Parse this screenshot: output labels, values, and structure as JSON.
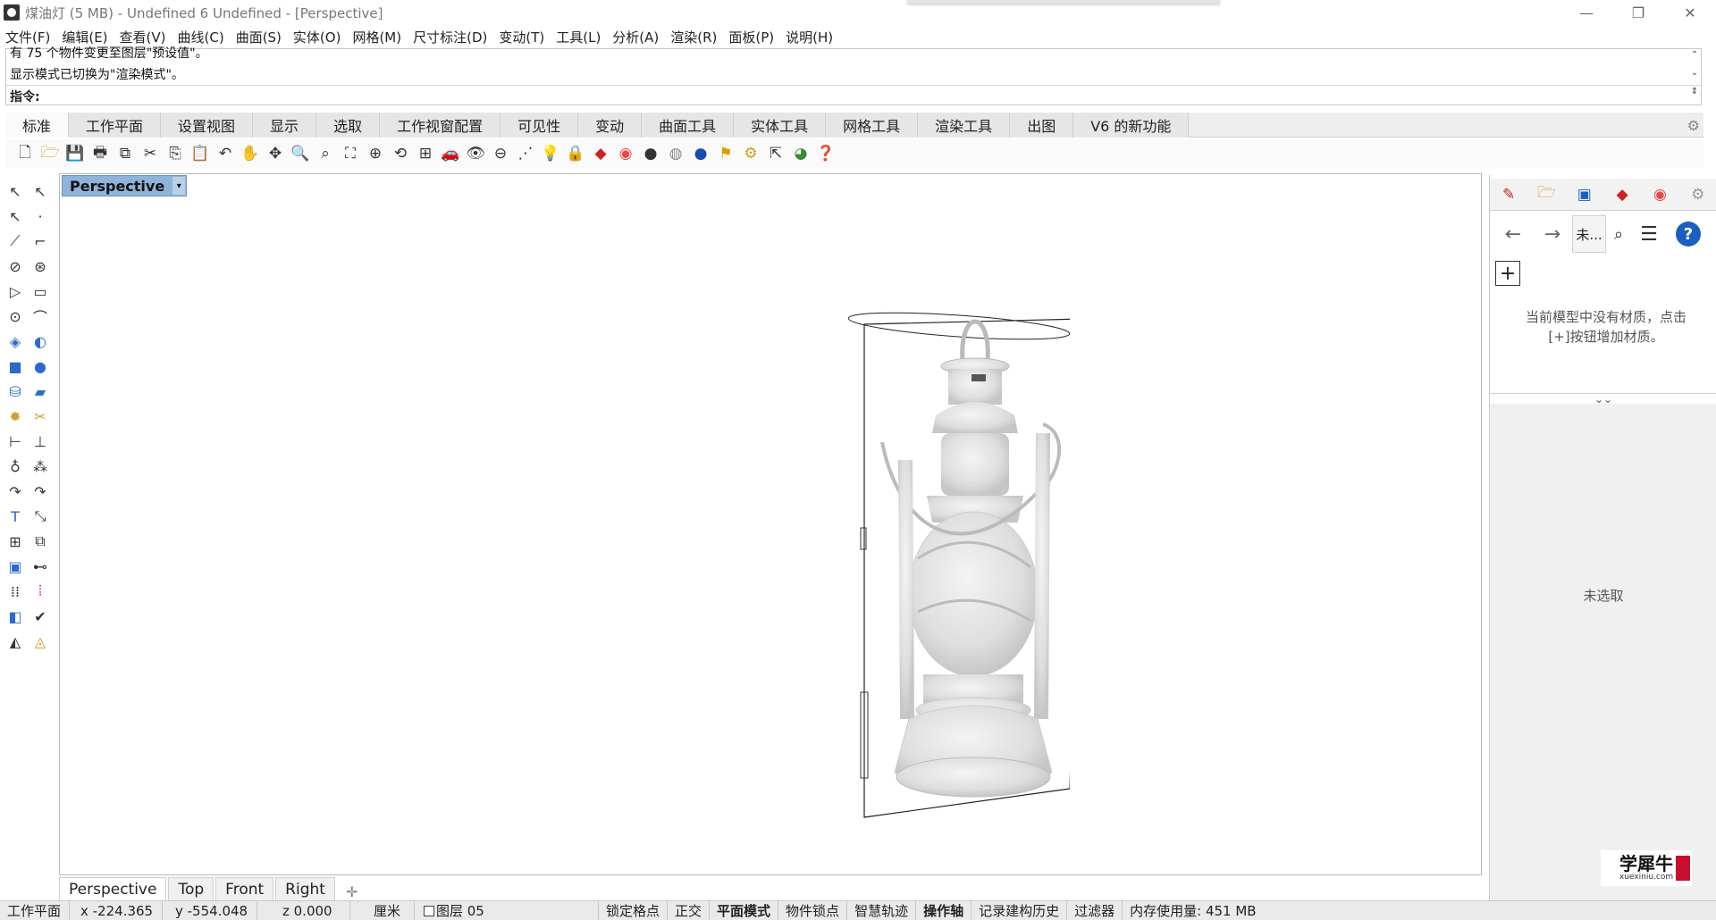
{
  "window": {
    "title": "煤油灯 (5 MB) - Undefined 6 Undefined - [Perspective]",
    "controls": {
      "minimize": "—",
      "restore": "❐",
      "close": "✕"
    }
  },
  "menu": [
    "文件(F)",
    "编辑(E)",
    "查看(V)",
    "曲线(C)",
    "曲面(S)",
    "实体(O)",
    "网格(M)",
    "尺寸标注(D)",
    "变动(T)",
    "工具(L)",
    "分析(A)",
    "渲染(R)",
    "面板(P)",
    "说明(H)"
  ],
  "command": {
    "line1": "有 75 个物件变更至图层\"预设值\"。",
    "line2": "显示模式已切换为\"渲染模式\"。",
    "prompt": "指令:"
  },
  "tabs": [
    "标准",
    "工作平面",
    "设置视图",
    "显示",
    "选取",
    "工作视窗配置",
    "可见性",
    "变动",
    "曲面工具",
    "实体工具",
    "网格工具",
    "渲染工具",
    "出图",
    "V6 的新功能"
  ],
  "active_tab": "标准",
  "toolbar_icons": [
    "new-file-icon",
    "open-file-icon",
    "save-icon",
    "print-icon",
    "export-icon",
    "cut-icon",
    "copy-icon",
    "paste-icon",
    "undo-icon",
    "pan-hand-icon",
    "move-view-icon",
    "zoom-icon",
    "zoom-window-icon",
    "zoom-extents-icon",
    "zoom-selected-icon",
    "rotate-view-icon",
    "four-views-icon",
    "car-icon",
    "camera-icon",
    "target-icon",
    "snap-icon",
    "light-icon",
    "lock-icon",
    "material-icon",
    "color-wheel-icon",
    "sphere-icon",
    "render-sphere-icon",
    "blue-sphere-icon",
    "flag-icon",
    "settings-gear-icon",
    "select-icon",
    "globe-icon",
    "help-icon"
  ],
  "viewport": {
    "title": "Perspective"
  },
  "viewport_tabs": [
    "Perspective",
    "Top",
    "Front",
    "Right"
  ],
  "right_panel": {
    "search_text": "未...",
    "empty_message_line1": "当前模型中没有材质，点击",
    "empty_message_line2": "[+]按钮增加材质。",
    "unselected": "未选取",
    "add_label": "+",
    "logo_main": "学犀牛",
    "logo_sub": "xuexiniu.com"
  },
  "status": {
    "cplane": "工作平面",
    "x": "x -224.365",
    "y": "y -554.048",
    "z": "z 0.000",
    "unit": "厘米",
    "layer": "图层 05",
    "lock_grid": "锁定格点",
    "ortho": "正交",
    "planar": "平面模式",
    "osnap": "物件锁点",
    "smart_track": "智慧轨迹",
    "gumball": "操作轴",
    "history": "记录建构历史",
    "filter": "过滤器",
    "memory": "内存使用量: 451 MB"
  }
}
